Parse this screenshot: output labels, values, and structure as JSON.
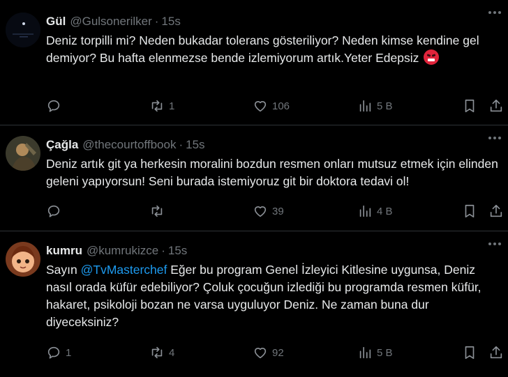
{
  "tweets": [
    {
      "name": "Gül",
      "handle": "@Gulsonerilker",
      "time": "15s",
      "text_main": "Deniz torpilli mi? Neden bukadar tolerans gösteriliyor? Neden kimse kendine gel demiyor? Bu hafta elenmezse bende izlemiyorum artık.Yeter Edepsiz",
      "emoji": "face-with-symbols-on-mouth",
      "reply_count": "",
      "retweet_count": "1",
      "like_count": "106",
      "view_count": "5 B"
    },
    {
      "name": "Çağla",
      "handle": "@thecourtoffbook",
      "time": "15s",
      "text_main": "Deniz artık git ya herkesin moralini bozdun resmen onları mutsuz etmek için elinden geleni yapıyorsun! Seni burada istemiyoruz git bir doktora tedavi ol!",
      "reply_count": "",
      "retweet_count": "",
      "like_count": "39",
      "view_count": "4 B"
    },
    {
      "name": "kumru",
      "handle": "@kumrukizce",
      "time": "15s",
      "text_prefix": "Sayın ",
      "mention": "@TvMasterchef",
      "text_main": "  Eğer bu program Genel İzleyici Kitlesine uygunsa, Deniz nasıl orada küfür edebiliyor? Çoluk çocuğun izlediği bu programda resmen küfür, hakaret, psikoloji bozan ne varsa uyguluyor Deniz. Ne zaman buna dur diyeceksiniz?",
      "reply_count": "1",
      "retweet_count": "4",
      "like_count": "92",
      "view_count": "5 B"
    }
  ],
  "dot_separator": "·"
}
